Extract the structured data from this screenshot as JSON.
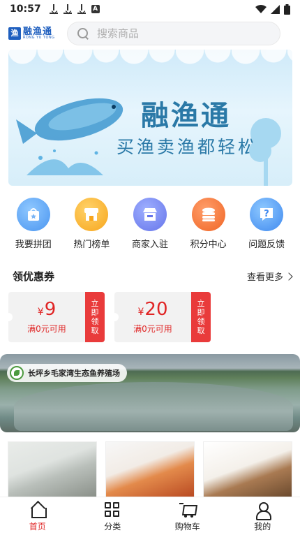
{
  "status_bar": {
    "time": "10:57",
    "icons": [
      "download-icon",
      "download-icon",
      "download-icon",
      "a-icon",
      "wifi-icon",
      "signal-icon",
      "battery-icon"
    ]
  },
  "header": {
    "logo_cn": "融渔通",
    "logo_en": "RONG YU TONG",
    "logo_mark": "渔",
    "search_placeholder": "搜索商品"
  },
  "banner": {
    "brand": "融渔通",
    "slogan": "买渔卖渔都轻松"
  },
  "menu": {
    "items": [
      {
        "label": "我要拼团",
        "icon": "bag-icon",
        "color": "#4a95f0"
      },
      {
        "label": "热门榜单",
        "icon": "shop-icon",
        "color": "#f7a51c"
      },
      {
        "label": "商家入驻",
        "icon": "store-icon",
        "color": "#6574ea"
      },
      {
        "label": "积分中心",
        "icon": "coins-icon",
        "color": "#f06525"
      },
      {
        "label": "问题反馈",
        "icon": "question-icon",
        "color": "#3f89ef"
      }
    ]
  },
  "coupons": {
    "title": "领优惠券",
    "more": "查看更多",
    "items": [
      {
        "currency": "¥",
        "amount": "9",
        "condition": "满0元可用",
        "claim": "立即领取"
      },
      {
        "currency": "¥",
        "amount": "20",
        "condition": "满0元可用",
        "claim": "立即领取"
      }
    ]
  },
  "farm": {
    "name": "长坪乡毛家湾生态鱼养殖场"
  },
  "products": [
    "fish-image",
    "lobster-image",
    "crab-image"
  ],
  "tabbar": {
    "active_color": "#e02424",
    "tabs": [
      {
        "label": "首页",
        "icon": "home-icon",
        "active": true
      },
      {
        "label": "分类",
        "icon": "grid-icon",
        "active": false
      },
      {
        "label": "购物车",
        "icon": "cart-icon",
        "active": false
      },
      {
        "label": "我的",
        "icon": "user-icon",
        "active": false
      }
    ]
  }
}
